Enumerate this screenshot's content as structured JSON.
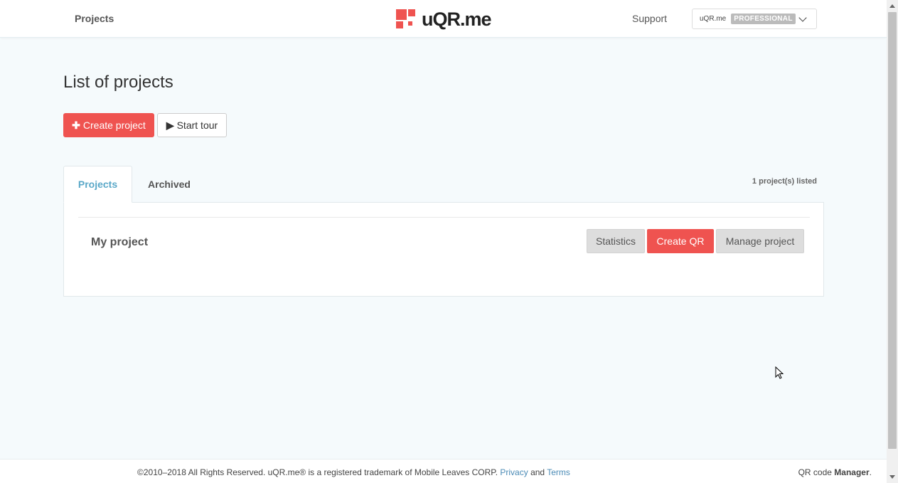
{
  "header": {
    "nav_projects": "Projects",
    "logo_text": "uQR.me",
    "nav_support": "Support",
    "account_name": "uQR.me",
    "account_badge": "PROFESSIONAL"
  },
  "main": {
    "title": "List of projects",
    "create_project_label": "Create project",
    "start_tour_label": "Start tour",
    "tabs": [
      {
        "label": "Projects",
        "active": true
      },
      {
        "label": "Archived",
        "active": false
      }
    ],
    "count_label": "1 project(s) listed",
    "projects": [
      {
        "name": "My project",
        "statistics_label": "Statistics",
        "create_qr_label": "Create QR",
        "manage_label": "Manage project"
      }
    ]
  },
  "footer": {
    "copyright": "©2010–2018 All Rights Reserved. uQR.me® is a registered trademark of Mobile Leaves CORP.",
    "privacy": "Privacy",
    "and": "and",
    "terms": "Terms",
    "right_prefix": "QR code",
    "right_bold": "Manager",
    "right_suffix": "."
  },
  "icons": {
    "create_project": "plus-icon",
    "start_tour": "play-icon",
    "account": "chevron-down-icon"
  },
  "colors": {
    "accent": "#ef5350",
    "tab_active": "#5aa8c8",
    "link": "#4b8bb6",
    "background": "#f5fafc"
  }
}
